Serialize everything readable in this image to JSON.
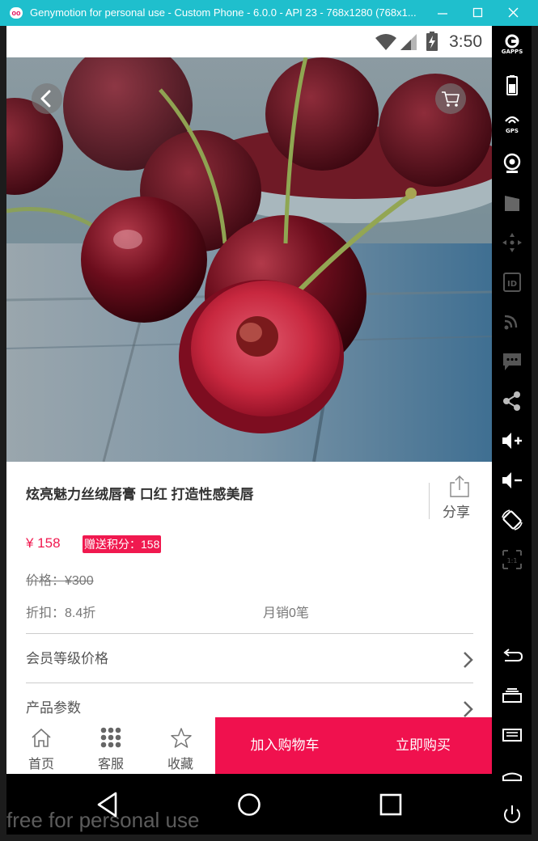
{
  "window": {
    "title": "Genymotion for personal use - Custom Phone - 6.0.0 - API 23 - 768x1280 (768x1...",
    "app_icon": "oo"
  },
  "statusbar": {
    "time": "3:50",
    "icons": [
      "wifi-icon",
      "signal-icon",
      "battery-charging-icon"
    ]
  },
  "hero": {
    "back_icon": "chevron-left-icon",
    "cart_icon": "shopping-cart-icon"
  },
  "product": {
    "name": "炫亮魅力丝绒唇膏 口红 打造性感美唇",
    "share_label": "分享",
    "price": "¥ 158",
    "points_badge": "赠送积分：158",
    "original_price": "价格：¥300",
    "discount": "折扣：8.4折",
    "monthly_sales": "月销0笔"
  },
  "rows": [
    {
      "label": "会员等级价格"
    },
    {
      "label": "产品参数"
    }
  ],
  "bottom_bar": {
    "tabs": [
      {
        "label": "首页",
        "icon": "home-icon"
      },
      {
        "label": "客服",
        "icon": "grid-dots-icon"
      },
      {
        "label": "收藏",
        "icon": "star-icon"
      }
    ],
    "add_to_cart": "加入购物车",
    "buy_now": "立即购买"
  },
  "navbar": {
    "watermark": "free for personal use",
    "buttons": [
      "back-triangle-icon",
      "home-circle-icon",
      "recents-square-icon"
    ]
  },
  "sidebar": {
    "gapps_label": "GAPPS",
    "gps_label": "GPS",
    "id_label": "ID",
    "ratio_label": "1:1"
  },
  "colors": {
    "accent": "#f0114e",
    "titlebar": "#1fbfcd"
  }
}
